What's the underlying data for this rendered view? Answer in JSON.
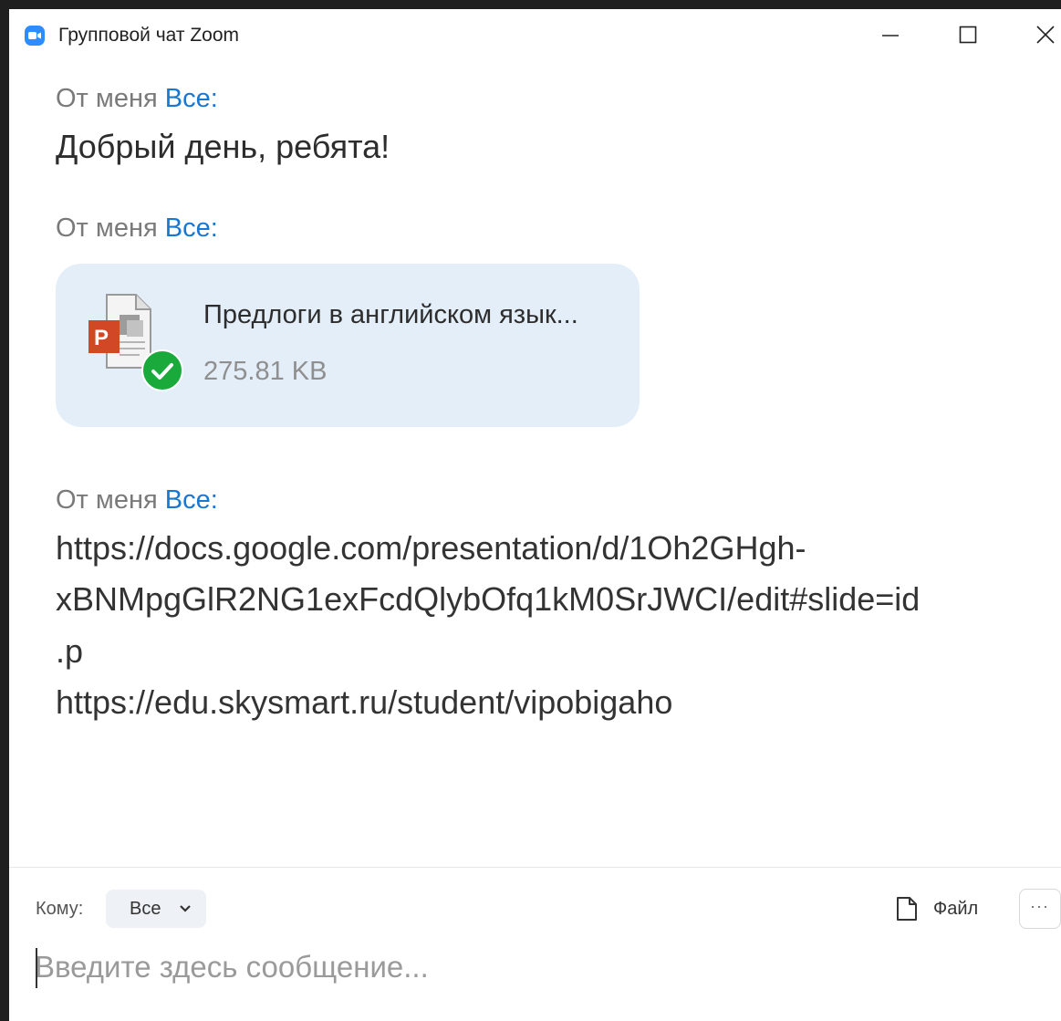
{
  "window": {
    "title": "Групповой чат Zoom",
    "controls": [
      "minimize",
      "maximize",
      "close"
    ]
  },
  "messages": [
    {
      "sender": "От меня",
      "recipient": "Все:",
      "text": "Добрый день, ребята!"
    },
    {
      "sender": "От меня",
      "recipient": "Все:",
      "file": {
        "name": "Предлоги в английском язык...",
        "size": "275.81 KB",
        "icon": "powerpoint-file-icon",
        "status_icon": "check-icon"
      }
    },
    {
      "sender": "От меня",
      "recipient": "Все:",
      "lines": [
        "https://docs.google.com/presentation/d/1Oh2GHgh-",
        "xBNMpgGlR2NG1exFcdQlybOfq1kM0SrJWCI/edit#slide=id",
        ".p",
        "https://edu.skysmart.ru/student/vipobigaho"
      ]
    }
  ],
  "composer": {
    "to_label": "Кому:",
    "to_value": "Все",
    "file_label": "Файл",
    "more_label": "···",
    "placeholder": "Введите здесь сообщение..."
  },
  "colors": {
    "accent": "#1877d2",
    "file_card_bg": "#e3eef8",
    "success": "#1aaa3c",
    "powerpoint": "#d24726"
  }
}
